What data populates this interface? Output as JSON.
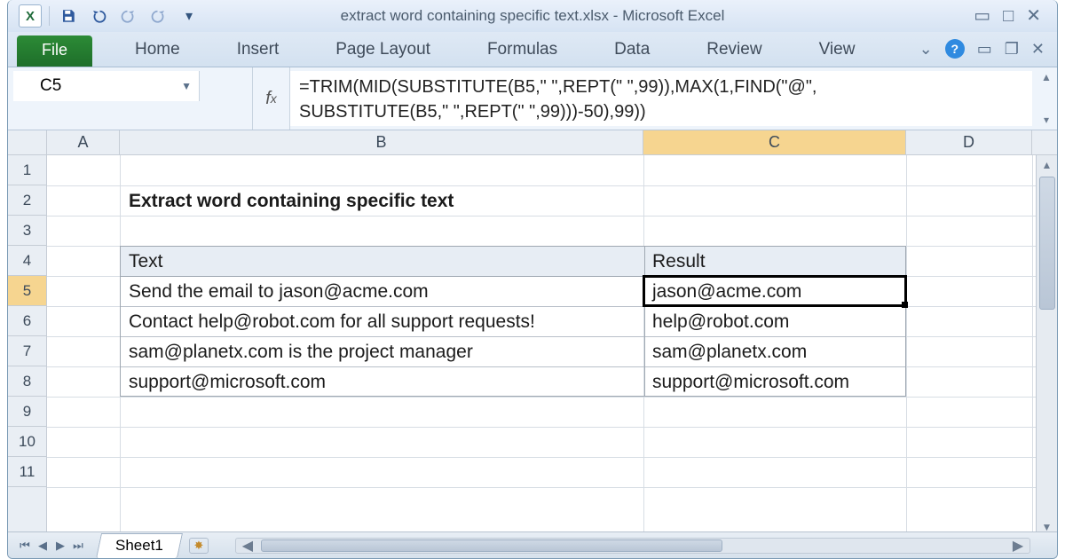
{
  "title": "extract word containing specific text.xlsx  -  Microsoft Excel",
  "qat": {
    "excel_letter": "X"
  },
  "ribbon": {
    "file": "File",
    "tabs": [
      "Home",
      "Insert",
      "Page Layout",
      "Formulas",
      "Data",
      "Review",
      "View"
    ]
  },
  "namebox": "C5",
  "formula_line1": "=TRIM(MID(SUBSTITUTE(B5,\" \",REPT(\" \",99)),MAX(1,FIND(\"@\",",
  "formula_line2": "SUBSTITUTE(B5,\" \",REPT(\" \",99)))-50),99))",
  "columns": [
    "A",
    "B",
    "C",
    "D"
  ],
  "rows": [
    "1",
    "2",
    "3",
    "4",
    "5",
    "6",
    "7",
    "8",
    "9",
    "10",
    "11"
  ],
  "heading": "Extract word containing specific text",
  "table": {
    "head_text": "Text",
    "head_result": "Result",
    "rows": [
      {
        "text": "Send the email to jason@acme.com",
        "result": "jason@acme.com"
      },
      {
        "text": "Contact help@robot.com for all support requests!",
        "result": "help@robot.com"
      },
      {
        "text": "sam@planetx.com is the project manager",
        "result": "sam@planetx.com"
      },
      {
        "text": "support@microsoft.com",
        "result": "support@microsoft.com"
      }
    ]
  },
  "sheet_tab": "Sheet1",
  "active_cell": "C5"
}
